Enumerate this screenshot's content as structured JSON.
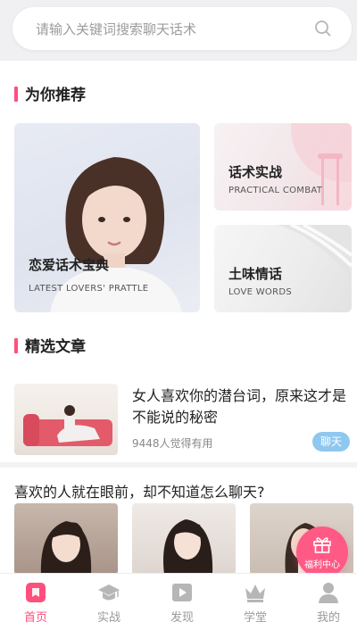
{
  "search": {
    "placeholder": "请输入关键词搜索聊天话术",
    "icon": "search-icon"
  },
  "sections": {
    "recommend_title": "为你推荐",
    "articles_title": "精选文章"
  },
  "recommend": {
    "big": {
      "title": "恋爱话术宝典",
      "subtitle": "LATEST LOVERS' PRATTLE"
    },
    "small": [
      {
        "title": "话术实战",
        "subtitle": "PRACTICAL COMBAT"
      },
      {
        "title": "土味情话",
        "subtitle": "LOVE WORDS"
      }
    ]
  },
  "article": {
    "title": "女人喜欢你的潜台词，原来这才是不能说的秘密",
    "meta": "9448人觉得有用",
    "tag": "聊天"
  },
  "question": "喜欢的人就在眼前，却不知道怎么聊天?",
  "welfare": {
    "label": "福利中心",
    "icon": "gift-icon"
  },
  "tabs": [
    {
      "label": "首页",
      "icon": "home-icon",
      "active": true
    },
    {
      "label": "实战",
      "icon": "graduation-cap-icon",
      "active": false
    },
    {
      "label": "发现",
      "icon": "play-icon",
      "active": false
    },
    {
      "label": "学堂",
      "icon": "crown-icon",
      "active": false
    },
    {
      "label": "我的",
      "icon": "user-icon",
      "active": false
    }
  ],
  "colors": {
    "accent": "#ff4f7d",
    "tag": "#8fc8ef",
    "welfare": "#ff5a86"
  }
}
